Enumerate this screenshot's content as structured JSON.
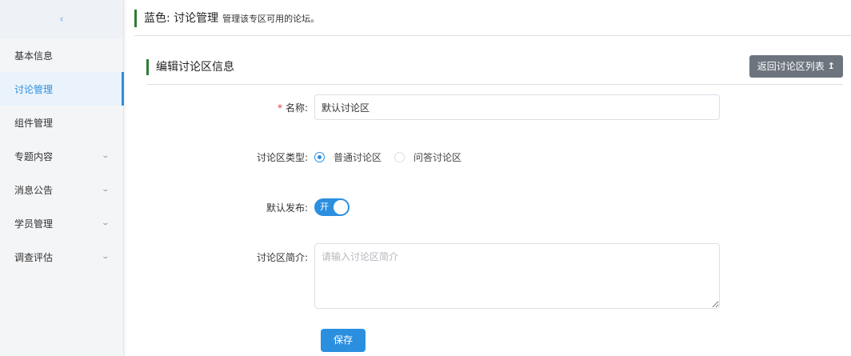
{
  "sidebar": {
    "collapse_icon": "chevron-left-icon",
    "collapse_glyph": "‹",
    "items": [
      {
        "label": "基本信息",
        "expandable": false
      },
      {
        "label": "讨论管理",
        "expandable": false,
        "active": true
      },
      {
        "label": "组件管理",
        "expandable": false
      },
      {
        "label": "专题内容",
        "expandable": true
      },
      {
        "label": "消息公告",
        "expandable": true
      },
      {
        "label": "学员管理",
        "expandable": true
      },
      {
        "label": "调查评估",
        "expandable": true
      }
    ],
    "chevron_glyph": "⌄"
  },
  "header": {
    "title": "蓝色: 讨论管理",
    "subtitle": "管理该专区可用的论坛。"
  },
  "section": {
    "title": "编辑讨论区信息",
    "back_button_label": "返回讨论区列表",
    "back_icon": "arrow-up-icon",
    "back_glyph": "↥"
  },
  "form": {
    "name": {
      "required_mark": "*",
      "label": "名称:",
      "value": "默认讨论区"
    },
    "type": {
      "label": "讨论区类型:",
      "options": [
        {
          "label": "普通讨论区",
          "checked": true
        },
        {
          "label": "问答讨论区",
          "checked": false
        }
      ]
    },
    "publish": {
      "label": "默认发布:",
      "switch_text": "开",
      "on": true
    },
    "intro": {
      "label": "讨论区简介:",
      "placeholder": "请输入讨论区简介",
      "value": ""
    },
    "save_label": "保存"
  },
  "colors": {
    "accent": "#2b8fe0",
    "title_bar": "#2e7d32",
    "back_button": "#6c757d",
    "required": "#e53935"
  }
}
